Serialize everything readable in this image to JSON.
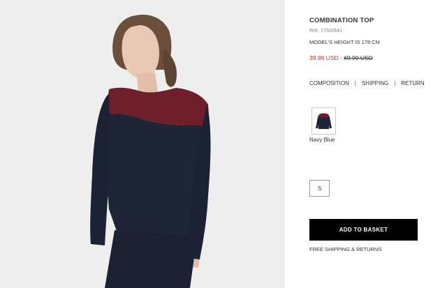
{
  "product": {
    "title": "COMBINATION TOP",
    "ref": "Ref. 7760/841",
    "model_height": "MODEL'S HEIGHT IS 178 CM",
    "price_sale": "39.99 USD",
    "price_separator": "-",
    "price_original": "69.90 USD"
  },
  "info_links": [
    "COMPOSITION",
    "SHIPPING",
    "RETURN"
  ],
  "info_link_separator": "|",
  "colors": {
    "selected_name": "Navy Blue",
    "navy": "#1d2536",
    "burgundy": "#6e1f2a",
    "sale_red": "#c0392b"
  },
  "sizes": [
    "S"
  ],
  "actions": {
    "add_to_basket": "ADD TO BASKET",
    "free_shipping": "FREE SHIPPING & RETURNS"
  }
}
